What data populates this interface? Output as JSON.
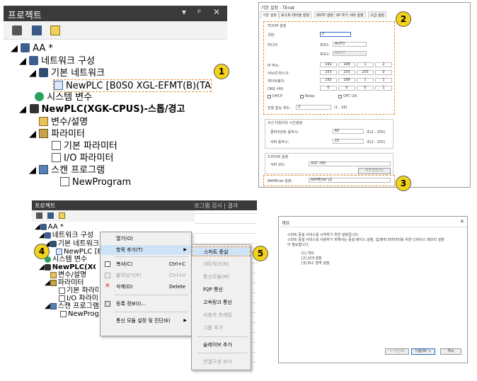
{
  "project": {
    "title": "프로젝트",
    "controls": [
      "▾",
      "ᵖ",
      "✕"
    ],
    "tree": {
      "root": "AA *",
      "network_config": "네트워크 구성",
      "basic_network": "기본 네트워크",
      "plc_item": "NewPLC [B0S0 XGL-EFMT(B)(TA",
      "system_vars": "시스템 변수",
      "cpu": "NewPLC(XGK-CPUS)-스톱/경고",
      "var_desc": "변수/설명",
      "parameters": "파라미터",
      "basic_param": "기본 파라미터",
      "io_param": "I/O 파라미터",
      "scan_program": "스캔 프로그램",
      "new_program": "NewProgram"
    }
  },
  "badges": [
    "1",
    "2",
    "3",
    "4",
    "5"
  ],
  "settings_dialog": {
    "title": "기본 설정 - TEnet",
    "tabs": [
      "기본 설정",
      "호스트 테이블 설정",
      "SNTP 설정",
      "SP 주기 서버 설정",
      "고급 설정"
    ],
    "group_title": "TCP/IP 설정",
    "station_label": "국번:",
    "station_value": "0",
    "media_label": "미디어:",
    "port1_label": "포트1:",
    "port1_value": "AUTO",
    "port2_label": "포트2:",
    "port2_value": "AUTO",
    "ip_label": "IP 주소:",
    "ip": [
      "192",
      "168",
      "1",
      "2"
    ],
    "mask_label": "서브넷 마스크:",
    "mask": [
      "255",
      "255",
      "255",
      "0"
    ],
    "gw_label": "게이트웨이:",
    "gw": [
      "192",
      "168",
      "1",
      "1"
    ],
    "dns_label": "DNS 서버:",
    "dns": [
      "0",
      "0",
      "0",
      "1"
    ],
    "dhcp": "DHCP",
    "relay": "Relay",
    "opcua": "OPC UA",
    "conn_label": "전용 접속 개수:",
    "conn_value": "3",
    "conn_range": "(1 - 16)",
    "timeout_title": "수신 타임아웃 시간설정",
    "client_label": "클라이언트 동작시:",
    "client_value": "60",
    "client_unit": "초(2 - 255)",
    "server_label": "서버 동작시:",
    "server_value": "15",
    "server_unit": "초(2 - 255)",
    "driver_title": "드라이버 설정",
    "server_mode_label": "서버 모드:",
    "server_mode_value": "XGT 서버",
    "detail_button": "세부설정(D)",
    "rapi_label": "RAPIEnet 설정:",
    "rapi_value": "RAPIEnet v2"
  },
  "context_panel": {
    "title": "프로젝트",
    "editor_tab": "프로그램 검사 | 결과",
    "menu": {
      "open": "열기(O)",
      "add_item": "항목 추가(T)",
      "copy": "복사(C)",
      "copy_shortcut": "Ctrl+C",
      "paste": "붙여넣기(P)",
      "paste_shortcut": "Ctrl+V",
      "delete": "삭제(D)",
      "delete_shortcut": "Delete",
      "properties": "등록 정보(I)...",
      "comm_module": "통신 모듈 설정 및 진단(E)"
    },
    "submenu": {
      "smart_expansion": "스마트 증설",
      "network": "네트워크(N)",
      "comm_module": "통신모듈(M)",
      "p2p": "P2P 통신",
      "hslink": "고속링크 통신",
      "user_frame": "사용자 프레임",
      "group_add": "그룹 추가",
      "slave_add": "슬레이브 추가",
      "view_link": "연결구성 보기"
    }
  },
  "wizard": {
    "title": "개요",
    "close": "✕",
    "line1": "스마트 증설 서비스를 시작하기 위한 설정입니다.",
    "line2": "스마트 증설 서비스를 사용하기 위해서는 증설 베이스 설정, 입/출력 파라미터를 위한 디바이스 메모리 설정",
    "line3": "이 필요합니다.",
    "item1": "[1] 개요",
    "item2": "[2] 상세 설정",
    "item3": "[3] PLC 영역 설정",
    "prev": "< 이전(B)",
    "next": "다음(N) >",
    "cancel": "취소"
  }
}
